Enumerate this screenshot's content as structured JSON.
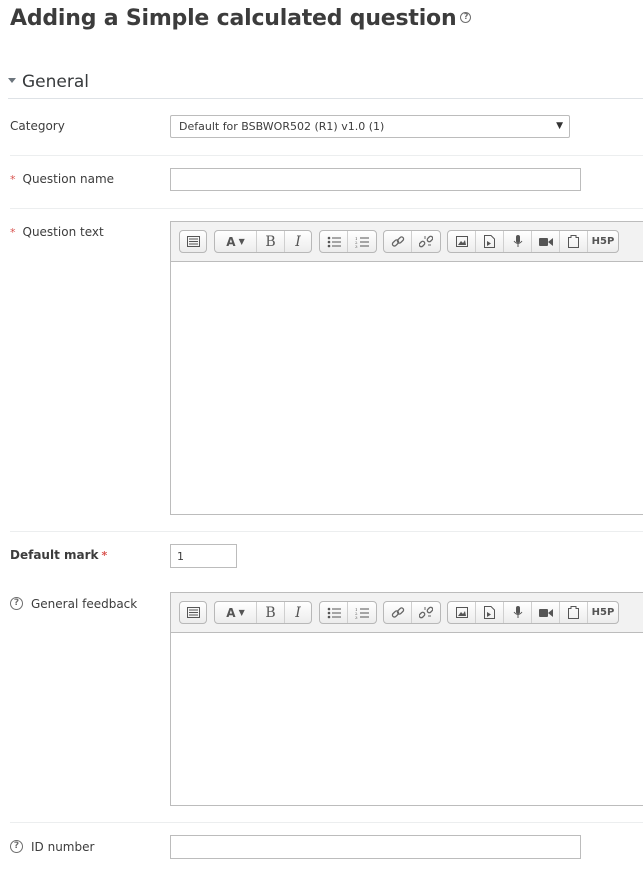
{
  "page": {
    "title": "Adding a Simple calculated question"
  },
  "icons": {
    "help": "?",
    "dropdown": "▼"
  },
  "section": {
    "title": "General"
  },
  "fields": {
    "category": {
      "label": "Category",
      "value": "Default for BSBWOR502 (R1) v1.0 (1)"
    },
    "question_name": {
      "label": "Question name",
      "required_mark": "*",
      "value": ""
    },
    "question_text": {
      "label": "Question text",
      "required_mark": "*"
    },
    "default_mark": {
      "label": "Default mark",
      "required_mark": "*",
      "value": "1"
    },
    "general_feedback": {
      "label": "General feedback"
    },
    "id_number": {
      "label": "ID number",
      "value": ""
    }
  },
  "toolbar": {
    "buttons": [
      "toolbar-toggle-icon",
      "font-style-icon",
      "bold-icon",
      "italic-icon",
      "unordered-list-icon",
      "ordered-list-icon",
      "link-icon",
      "unlink-icon",
      "image-icon",
      "media-icon",
      "microphone-icon",
      "video-icon",
      "manage-files-icon",
      "h5p-icon"
    ],
    "bold_glyph": "B",
    "italic_glyph": "I",
    "font_glyph": "A",
    "h5p_label": "H5P"
  }
}
